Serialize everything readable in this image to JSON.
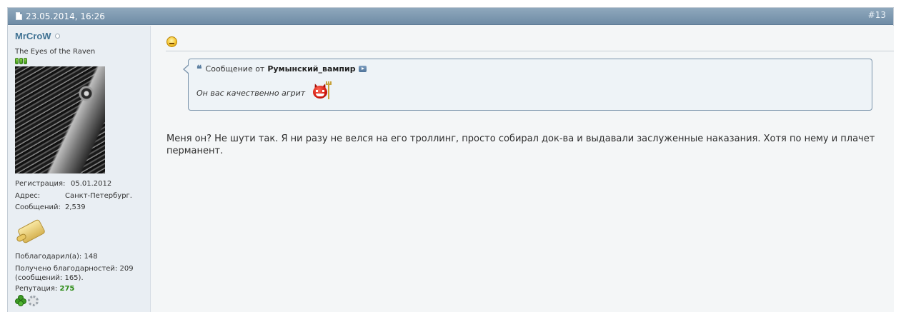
{
  "post": {
    "date": "23.05.2014, 16:26",
    "number": "#13",
    "user": {
      "name": "MrCroW",
      "title": "The Eyes of the Raven",
      "reputation_pips": 3,
      "stats": {
        "reg_label": "Регистрация:",
        "reg_value": "05.01.2012",
        "addr_label": "Адрес:",
        "addr_value": "Санкт-Петербург.",
        "posts_label": "Сообщений:",
        "posts_value": "2,539"
      },
      "thanked_label": "Поблагодарил(а):",
      "thanked_value": "148",
      "received_line1": "Получено благодарностей: 209",
      "received_line2": "(сообщений: 165).",
      "rep_label": "Репутация:",
      "rep_value": "275"
    },
    "quote": {
      "prefix": "Сообщение от",
      "author": "Румынский_вампир",
      "text": "Он вас качественно агрит"
    },
    "message": "Меня он? Не шути так. Я ни разу не велся на его троллинг, просто собирал док-ва и выдавали заслуженные наказания. Хотя по нему и плачет перманент.",
    "icons": {
      "post": "document-icon",
      "online": "status-offline-icon",
      "smilie": "sad-smilie-icon",
      "quote": "quote-marks-icon",
      "jump": "view-post-icon",
      "devil": "devil-smilie-icon",
      "award": "scroll-award-icon",
      "clover": "clover-icon",
      "gear": "gear-icon"
    },
    "colors": {
      "header": "#7891a9",
      "username": "#417394",
      "reputation": "#2a8a13",
      "quote_border": "#7b94ab"
    }
  }
}
